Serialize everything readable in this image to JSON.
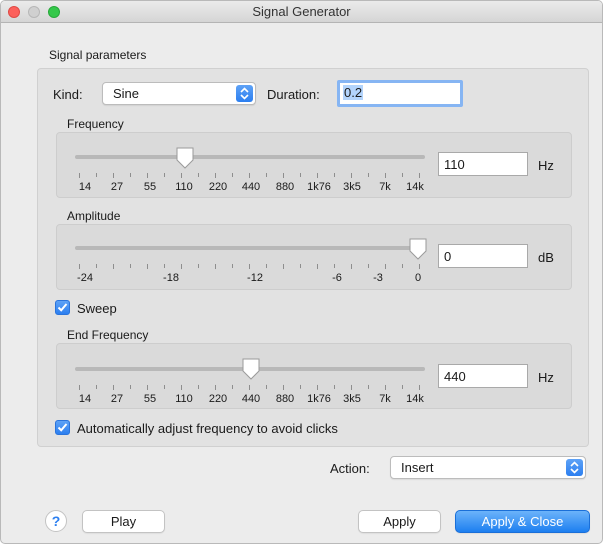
{
  "window": {
    "title": "Signal Generator"
  },
  "group": {
    "label": "Signal parameters"
  },
  "kind": {
    "label": "Kind:",
    "value": "Sine"
  },
  "duration": {
    "label": "Duration:",
    "value": "0.2"
  },
  "frequency": {
    "label": "Frequency",
    "value": "110",
    "unit": "Hz",
    "slider_fraction": 0.3,
    "ticks": [
      "14",
      "27",
      "55",
      "110",
      "220",
      "440",
      "880",
      "1k76",
      "3k5",
      "7k",
      "14k"
    ]
  },
  "amplitude": {
    "label": "Amplitude",
    "value": "0",
    "unit": "dB",
    "slider_fraction": 1.0,
    "ticks": [
      "-24",
      "-18",
      "-12",
      "-6",
      "-3",
      "0"
    ]
  },
  "sweep": {
    "label": "Sweep",
    "checked": true
  },
  "end_frequency": {
    "label": "End Frequency",
    "value": "440",
    "unit": "Hz",
    "slider_fraction": 0.5,
    "ticks": [
      "14",
      "27",
      "55",
      "110",
      "220",
      "440",
      "880",
      "1k76",
      "3k5",
      "7k",
      "14k"
    ]
  },
  "auto_adjust": {
    "label": "Automatically adjust frequency to avoid clicks",
    "checked": true
  },
  "action": {
    "label": "Action:",
    "value": "Insert"
  },
  "buttons": {
    "help": "?",
    "play": "Play",
    "apply": "Apply",
    "apply_close": "Apply & Close"
  },
  "colors": {
    "accent": "#2c7ff0",
    "close": "#fc605b",
    "maximize": "#34c84a"
  }
}
